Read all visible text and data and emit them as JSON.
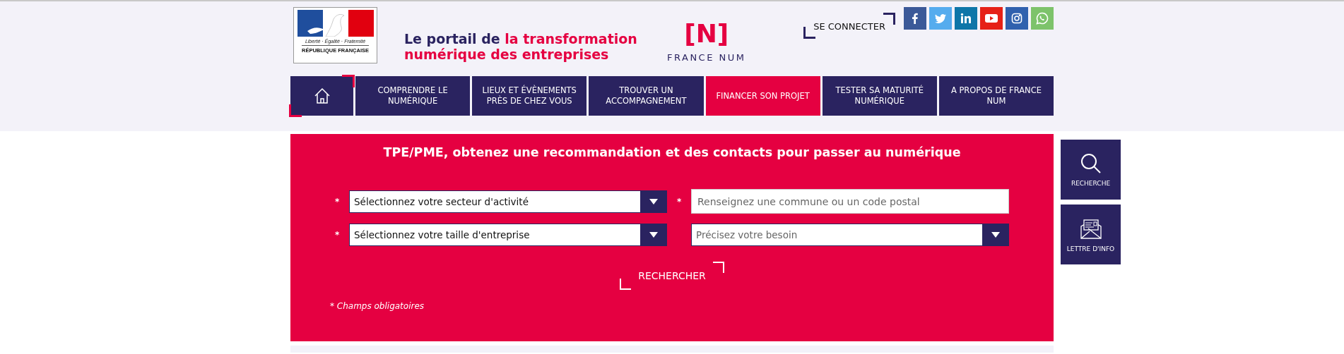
{
  "logo": {
    "motto": "Liberté · Égalité · Fraternité",
    "name": "RÉPUBLIQUE FRANÇAISE"
  },
  "tagline": {
    "lead": "Le portail de",
    "highlight": "la transformation numérique des entreprises"
  },
  "brand": {
    "mark": "[N]",
    "name": "FRANCE NUM"
  },
  "login": {
    "label": "SE CONNECTER"
  },
  "social": [
    {
      "kind": "facebook",
      "color": "#3b5998"
    },
    {
      "kind": "twitter",
      "color": "#55acee"
    },
    {
      "kind": "linkedin",
      "color": "#0e76a8"
    },
    {
      "kind": "youtube",
      "color": "#e62117"
    },
    {
      "kind": "instagram",
      "color": "#3061ae"
    },
    {
      "kind": "whatsapp",
      "color": "#7dc36b"
    }
  ],
  "nav": [
    {
      "kind": "home",
      "selected": false
    },
    {
      "kind": "link",
      "label": "COMPRENDRE LE NUMÉRIQUE",
      "selected": false
    },
    {
      "kind": "link",
      "label": "LIEUX ET ÉVÈNEMENTS PRÈS DE CHEZ VOUS",
      "selected": false
    },
    {
      "kind": "link",
      "label": "TROUVER UN ACCOMPAGNEMENT",
      "selected": false
    },
    {
      "kind": "link",
      "label": "FINANCER SON PROJET",
      "selected": true
    },
    {
      "kind": "link",
      "label": "TESTER SA MATURITÉ NUMÉRIQUE",
      "selected": false
    },
    {
      "kind": "link",
      "label": "A PROPOS DE FRANCE NUM",
      "selected": false
    }
  ],
  "search_form": {
    "title": "TPE/PME, obtenez une recommandation et des contacts pour passer au numérique",
    "fields": [
      {
        "kind": "select",
        "required": true,
        "value": "Sélectionnez votre secteur d'activité"
      },
      {
        "kind": "input",
        "required": true,
        "placeholder": "Renseignez une commune ou un code postal"
      },
      {
        "kind": "select",
        "required": true,
        "value": "Sélectionnez votre taille d'entreprise"
      },
      {
        "kind": "select",
        "required": false,
        "placeholder": "Précisez votre besoin"
      }
    ],
    "required_mark": "*",
    "submit": "RECHERCHER",
    "note": "* Champs obligatoires"
  },
  "side_buttons": [
    {
      "kind": "search",
      "label": "RECHERCHE"
    },
    {
      "kind": "newsletter",
      "label": "LETTRE D'INFO"
    }
  ]
}
